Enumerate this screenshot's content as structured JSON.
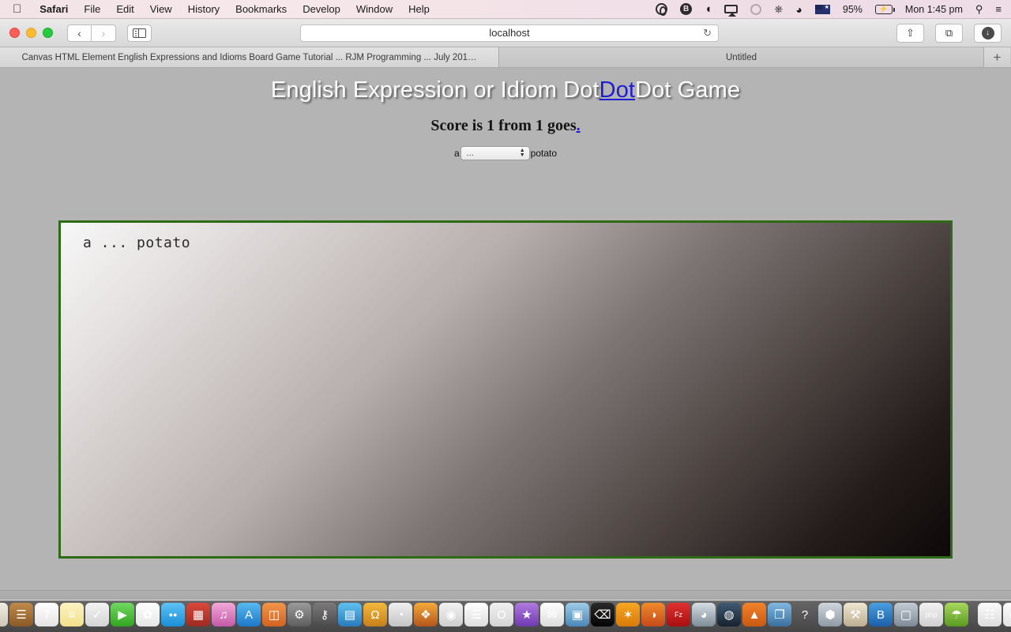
{
  "menubar": {
    "apple_icon": "apple-logo",
    "items": [
      {
        "label": "Safari",
        "bold": true
      },
      {
        "label": "File",
        "bold": false
      },
      {
        "label": "Edit",
        "bold": false
      },
      {
        "label": "View",
        "bold": false
      },
      {
        "label": "History",
        "bold": false
      },
      {
        "label": "Bookmarks",
        "bold": false
      },
      {
        "label": "Develop",
        "bold": false
      },
      {
        "label": "Window",
        "bold": false
      },
      {
        "label": "Help",
        "bold": false
      }
    ],
    "extras": {
      "battery_percent": "95%",
      "clock": "Mon 1:45 pm",
      "search_icon": "spotlight-search-icon",
      "notification_icon": "notification-center-icon",
      "flag_icon": "australia-flag-icon",
      "wifi_icon": "wifi-icon",
      "bluetooth_icon": "bluetooth-icon",
      "timemachine_icon": "time-machine-icon",
      "airplay_icon": "airplay-icon",
      "dropbox_icon": "dropbox-icon",
      "bittorrent_icon": "bittorrent-icon",
      "vpn_icon": "vpn-icon"
    }
  },
  "toolbar": {
    "back_label": "‹",
    "forward_label": "›",
    "sidebar_title": "Show sidebar",
    "url": "localhost",
    "reload_label": "↻",
    "share_label": "⇧",
    "tabs_label": "⧉",
    "downloads_label": "↓"
  },
  "tabs": [
    {
      "title": "Canvas HTML Element English Expressions and Idioms Board Game Tutorial ... RJM Programming ... July 201…",
      "active": false
    },
    {
      "title": "Untitled",
      "active": true
    }
  ],
  "tab_add_label": "+",
  "page": {
    "title_before": "English Expression or Idiom Dot",
    "title_link": "Dot",
    "title_after": "Dot Game",
    "score_text": "Score is 1 from 1 goes",
    "score_link": ".",
    "prefix_word": "a",
    "suffix_word": "potato",
    "select_value": "...",
    "select_options": [
      "..."
    ],
    "canvas_text": "a ... potato",
    "canvas_border_color": "#2d6b17",
    "background_color": "#b4b4b4",
    "link_color": "#1d1dd4"
  },
  "dock": {
    "items": [
      {
        "name": "finder",
        "glyph": "☺",
        "bg": "linear-gradient(to bottom,#7fd0f5,#2a7fc9)",
        "running": true
      },
      {
        "name": "launchpad",
        "glyph": "◉",
        "bg": "linear-gradient(to bottom,#e9e9e9,#b9b9b9)",
        "running": false
      },
      {
        "name": "safari",
        "glyph": "✥",
        "bg": "linear-gradient(to bottom,#e8f4ff,#9dc8ec)",
        "running": true
      },
      {
        "name": "contacts",
        "glyph": "✎",
        "bg": "linear-gradient(to bottom,#f0ece4,#cfc6b6)",
        "running": true
      },
      {
        "name": "address-book",
        "glyph": "☰",
        "bg": "linear-gradient(to bottom,#c08a4a,#8a5a27)",
        "running": false
      },
      {
        "name": "calendar",
        "glyph": "7",
        "bg": "linear-gradient(to bottom,#ffffff,#e4e4e4)",
        "running": false
      },
      {
        "name": "notes",
        "glyph": "≡",
        "bg": "linear-gradient(to bottom,#fdf3c2,#f2e08a)",
        "running": false
      },
      {
        "name": "reminders",
        "glyph": "✓",
        "bg": "linear-gradient(to bottom,#f3f3f3,#d5d5d5)",
        "running": false
      },
      {
        "name": "facetime",
        "glyph": "▶",
        "bg": "linear-gradient(to bottom,#6fd860,#32a520)",
        "running": false
      },
      {
        "name": "photos",
        "glyph": "✿",
        "bg": "linear-gradient(to bottom,#ffffff,#e6e6e6)",
        "running": false
      },
      {
        "name": "messages",
        "glyph": "●●",
        "bg": "linear-gradient(to bottom,#5ec2f5,#1a8fd8)",
        "running": true
      },
      {
        "name": "photo-booth",
        "glyph": "▦",
        "bg": "linear-gradient(to bottom,#d8493b,#9d2b21)",
        "running": false
      },
      {
        "name": "itunes",
        "glyph": "♫",
        "bg": "linear-gradient(to bottom,#f3a8d8,#c45aa8)",
        "running": true
      },
      {
        "name": "app-store",
        "glyph": "A",
        "bg": "linear-gradient(to bottom,#57b9f0,#1d78c8)",
        "running": false
      },
      {
        "name": "ibooks",
        "glyph": "◫",
        "bg": "linear-gradient(to bottom,#f2954a,#d4631f)",
        "running": false
      },
      {
        "name": "system-preferences",
        "glyph": "⚙",
        "bg": "linear-gradient(to bottom,#9a9a9a,#5e5e5e)",
        "running": false
      },
      {
        "name": "keychain",
        "glyph": "⚷",
        "bg": "linear-gradient(to bottom,#7a7a7a,#4a4a4a)",
        "running": false
      },
      {
        "name": "disk-utility",
        "glyph": "▤",
        "bg": "linear-gradient(to bottom,#5ec0ef,#2a7bbd)",
        "running": true
      },
      {
        "name": "xampp",
        "glyph": "Ω",
        "bg": "linear-gradient(to bottom,#f3b93d,#c7801a)",
        "running": true
      },
      {
        "name": "pearl",
        "glyph": "◔",
        "bg": "linear-gradient(to bottom,#f0f0f0,#c4c4c4)",
        "running": true
      },
      {
        "name": "fireworks",
        "glyph": "❖",
        "bg": "linear-gradient(to bottom,#f5a93a,#b4561a)",
        "running": true
      },
      {
        "name": "chrome",
        "glyph": "◉",
        "bg": "linear-gradient(to bottom,#f2f2f2,#cfcfcf)",
        "running": true
      },
      {
        "name": "textedit",
        "glyph": "☰",
        "bg": "linear-gradient(to bottom,#ffffff,#dedede)",
        "running": true
      },
      {
        "name": "opera",
        "glyph": "O",
        "bg": "linear-gradient(to bottom,#f0f0f0,#d4d4d4)",
        "running": true
      },
      {
        "name": "vivaldi",
        "glyph": "★",
        "bg": "linear-gradient(to bottom,#b07ae0,#6f39b0)",
        "running": true
      },
      {
        "name": "preview",
        "glyph": "✉",
        "bg": "linear-gradient(to bottom,#ffffff,#dcdcdc)",
        "running": true
      },
      {
        "name": "screenshot",
        "glyph": "▣",
        "bg": "linear-gradient(to bottom,#9ecbe8,#4a87b8)",
        "running": true
      },
      {
        "name": "terminal",
        "glyph": "⌫",
        "bg": "linear-gradient(to bottom,#2a2a2a,#050505)",
        "running": true
      },
      {
        "name": "avast",
        "glyph": "✶",
        "bg": "linear-gradient(to bottom,#f5a623,#d97a0a)",
        "running": true
      },
      {
        "name": "firefox",
        "glyph": "◑",
        "bg": "linear-gradient(to bottom,#f08a2a,#c64a1a)",
        "running": true
      },
      {
        "name": "filezilla",
        "glyph": "Fz",
        "bg": "linear-gradient(to bottom,#e03030,#a80f0f)",
        "running": true
      },
      {
        "name": "cyberduck",
        "glyph": "◕",
        "bg": "linear-gradient(to bottom,#d5dde3,#7e8d98)",
        "running": true
      },
      {
        "name": "steam",
        "glyph": "◍",
        "bg": "linear-gradient(to bottom,#3f5a73,#16222e)",
        "running": false
      },
      {
        "name": "vlc",
        "glyph": "▲",
        "bg": "linear-gradient(to bottom,#f2822a,#c95a12)",
        "running": false
      },
      {
        "name": "remote-desktop",
        "glyph": "❐",
        "bg": "linear-gradient(to bottom,#7fb8e0,#3a6f9e)",
        "running": false
      },
      {
        "name": "help-viewer",
        "glyph": "?",
        "bg": "transparent",
        "running": false
      },
      {
        "name": "virtualbox-box",
        "glyph": "⬢",
        "bg": "linear-gradient(to bottom,#cfd6dc,#8e9aa5)",
        "running": false
      },
      {
        "name": "automator",
        "glyph": "⚒",
        "bg": "linear-gradient(to bottom,#efe6d2,#bcae90)",
        "running": false
      },
      {
        "name": "bootstrap",
        "glyph": "B",
        "bg": "linear-gradient(to bottom,#4a9fe0,#1b5fa8)",
        "running": false
      },
      {
        "name": "virtualbox",
        "glyph": "▢",
        "bg": "linear-gradient(to bottom,#c3ccd4,#7d8a96)",
        "running": false
      },
      {
        "name": "php",
        "glyph": "php",
        "bg": "linear-gradient(to bottom,#f2f2f2,#d0d0d0)",
        "running": false
      },
      {
        "name": "xcode",
        "glyph": "☂",
        "bg": "linear-gradient(to bottom,#a8d85e,#5a9a20)",
        "running": true
      },
      {
        "name": "documents-stack",
        "glyph": "☷",
        "bg": "linear-gradient(to bottom,#fbfbfb,#dcdcdc)",
        "running": false
      },
      {
        "name": "downloads-stack",
        "glyph": "▭",
        "bg": "linear-gradient(to bottom,#fdfdfd,#e2e2e2)",
        "running": false
      },
      {
        "name": "desktop-stack",
        "glyph": "▥",
        "bg": "linear-gradient(to bottom,#fdfdfd,#e0e0e0)",
        "running": false
      },
      {
        "name": "files-stack",
        "glyph": "□",
        "bg": "linear-gradient(to bottom,#fdfdfd,#e4e4e4)",
        "running": false
      },
      {
        "name": "trash",
        "glyph": "ᵜ",
        "bg": "linear-gradient(to bottom,#e8e8e8,#b8b8b8)",
        "running": false
      }
    ]
  }
}
